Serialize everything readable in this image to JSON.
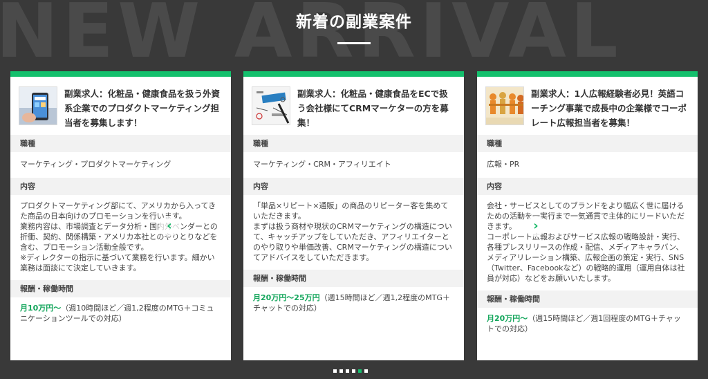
{
  "background_text": "NEW ARRIVAL",
  "section_title": "新着の副業案件",
  "accent_color": "#14c06d",
  "cards": [
    {
      "thumb_icon": "smartphone-photo-icon",
      "title": "副業求人：化粧品・健康食品を扱う外資系企業でのプロダクトマーケティング担当者を募集します！",
      "job_label": "職種",
      "job_value": "マーケティング・プロダクトマーケティング",
      "content_label": "内容",
      "content_value": "プロダクトマーケティング部にて、アメリカから入ってきた商品の日本向けのプロモーションを行います。\n業務内容は、市場調査とデータ分析・国内外ベンダーとの折衝、契約、関係構築・アメリカ本社とのやりとりなどを含む、プロモーション活動全般です。\n※ディレクターの指示に基づいて業務を行います。細かい業務は面談にて決定していきます。",
      "pay_label": "報酬・稼働時間",
      "pay_amount": "月10万円～",
      "pay_detail": "（週10時間ほど／週1,2程度のMTG＋コミュニケーションツールでの対応）"
    },
    {
      "thumb_icon": "marketing-strategy-icon",
      "title": "副業求人：化粧品・健康食品をECで扱う会社様にてCRMマーケターの方を募集！",
      "job_label": "職種",
      "job_value": "マーケティング・CRM・アフィリエイト",
      "content_label": "内容",
      "content_value": "「単品×リピート×通販」の商品のリピーター客を集めていただきます。\nまずは扱う商材や現状のCRMマーケティングの構造について、キャッチアップをしていただき、アフィリエイターとのやり取りや単価改善、CRMマーケティングの構造についてアドバイスをしていただきます。",
      "pay_label": "報酬・稼働時間",
      "pay_amount": "月20万円～25万円",
      "pay_detail": "（週15時間ほど／週1,2程度のMTG＋チャットでの対応）"
    },
    {
      "thumb_icon": "people-chain-icon",
      "title": "副業求人：1人広報経験者必見！英語コーチング事業で成長中の企業様でコーポレート広報担当者を募集！",
      "job_label": "職種",
      "job_value": "広報・PR",
      "content_label": "内容",
      "content_value": "会社・サービスとしてのブランドをより幅広く世に届けるための活動を一実行まで一気通貫で主体的にリードいただきます。\nコーポレート広報およびサービス広報の戦略設計・実行、各種プレスリリースの作成・配信、メディアキャラバン、メディアリレーション構築、広報企画の策定・実行、SNS（Twitter、Facebookなど）の戦略的運用（運用自体は社員が対応）などをお願いいたします。",
      "pay_label": "報酬・稼働時間",
      "pay_amount": "月20万円～",
      "pay_detail": "（週15時間ほど／週1回程度のMTG＋チャットでの対応）"
    }
  ],
  "prev_arrow": "‹",
  "next_arrow": "›",
  "pagination": {
    "count": 6,
    "active_index": 4
  }
}
